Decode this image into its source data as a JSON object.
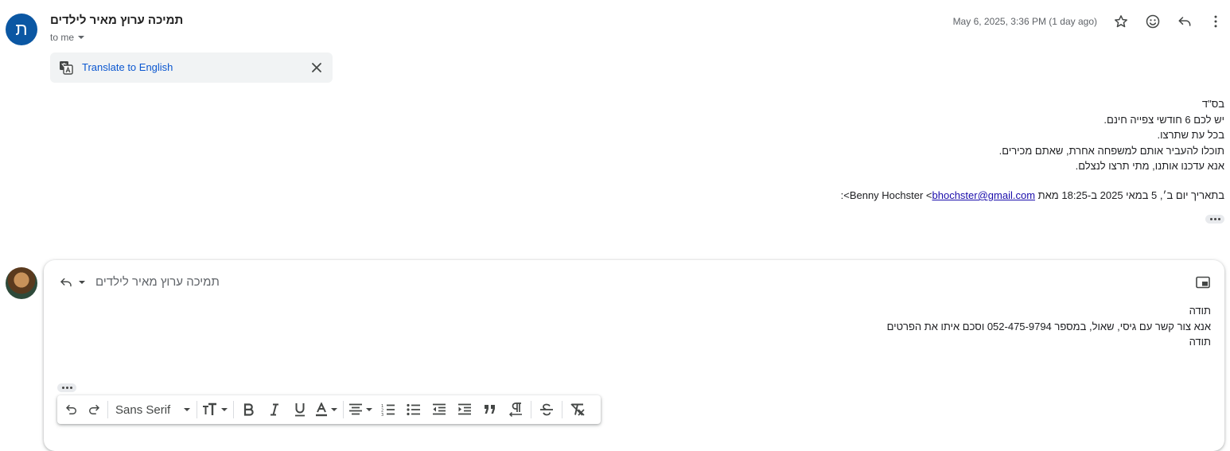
{
  "sender": {
    "avatar_letter": "ת",
    "name": "תמיכה ערוץ מאיר לילדים",
    "to_label": "to me",
    "date": "May 6, 2025, 3:36 PM (1 day ago)"
  },
  "header_icons": [
    "star-icon",
    "emoji-icon",
    "reply-icon",
    "more-vert-icon"
  ],
  "translate": {
    "link": "Translate to English"
  },
  "body": {
    "lines": [
      "בס\"ד",
      "יש לכם 6 חודשי צפייה חינם.",
      "בכל עת שתרצו.",
      "תוכלו להעביר אותם למשפחה אחרת, שאתם מכירים.",
      "אנא עדכנו אותנו, מתי תרצו לנצלם."
    ],
    "quote_prefix": "בתאריך יום ב׳, 5 במאי 2025 ב-18:25 מאת Benny Hochster <",
    "quote_email": "bhochster@gmail.com",
    "quote_suffix": ">:"
  },
  "compose": {
    "recipient": "תמיכה ערוץ מאיר לילדים",
    "lines": [
      "תודה",
      "אנא צור קשר עם גיסי, שאול, במספר 052-475-9794 וסכם איתו את הפרטים",
      "תודה"
    ],
    "toolbar": {
      "font": "Sans Serif"
    }
  },
  "colors": {
    "avatar": "#0b57a3",
    "link": "#0b57d0"
  }
}
